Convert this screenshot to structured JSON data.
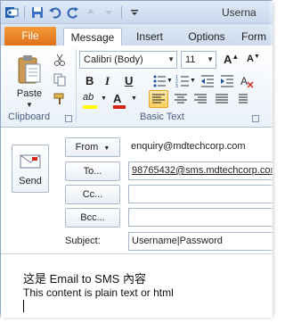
{
  "window": {
    "title": "Userna"
  },
  "tabs": {
    "file": "File",
    "message": "Message",
    "insert": "Insert",
    "options": "Options",
    "format": "Form"
  },
  "clipboard": {
    "paste_label": "Paste",
    "group_label": "Clipboard"
  },
  "basic_text": {
    "font_name": "Calibri (Body)",
    "font_size": "11",
    "bold": "B",
    "italic": "I",
    "underline": "U",
    "grow_font": "A",
    "shrink_font": "A",
    "highlight_label": "ab",
    "font_color_label": "A",
    "group_label": "Basic Text"
  },
  "compose": {
    "send_label": "Send",
    "from_label": "From",
    "from_value": "enquiry@mdtechcorp.com",
    "to_label": "To...",
    "to_value": "98765432@sms.mdtechcorp.com",
    "cc_label": "Cc...",
    "cc_value": "",
    "bcc_label": "Bcc...",
    "bcc_value": "",
    "subject_label": "Subject:",
    "subject_value": "Username|Password"
  },
  "body": {
    "line1": "这是 Email to SMS 內容",
    "line2": "This content is plain text or html"
  },
  "colors": {
    "file_tab": "#e0701a",
    "ribbon_bg": "#e9f0f9",
    "highlight_yellow": "#ffff00",
    "font_red": "#d9261c",
    "selected_button": "#fbcf5b"
  }
}
